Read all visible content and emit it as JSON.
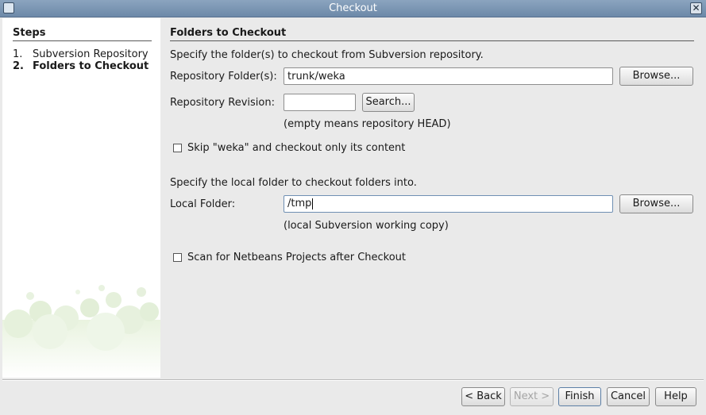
{
  "window": {
    "title": "Checkout"
  },
  "steps": {
    "title": "Steps",
    "items": [
      {
        "num": "1.",
        "label": "Subversion Repository"
      },
      {
        "num": "2.",
        "label": "Folders to Checkout"
      }
    ]
  },
  "panel": {
    "title": "Folders to Checkout",
    "intro": "Specify the folder(s) to checkout from Subversion repository.",
    "repo_folder_label": "Repository Folder(s):",
    "repo_folder_value": "trunk/weka",
    "browse_label": "Browse...",
    "revision_label": "Repository Revision:",
    "revision_value": "",
    "search_label": "Search...",
    "revision_hint": "(empty means repository HEAD)",
    "skip_label": "Skip \"weka\" and checkout only its content",
    "local_intro": "Specify the local folder to checkout folders into.",
    "local_folder_label": "Local Folder:",
    "local_folder_value": "/tmp",
    "local_browse_label": "Browse...",
    "local_hint": "(local Subversion working copy)",
    "scan_label": "Scan for Netbeans Projects after Checkout"
  },
  "buttons": {
    "back": "< Back",
    "next": "Next >",
    "finish": "Finish",
    "cancel": "Cancel",
    "help": "Help"
  }
}
